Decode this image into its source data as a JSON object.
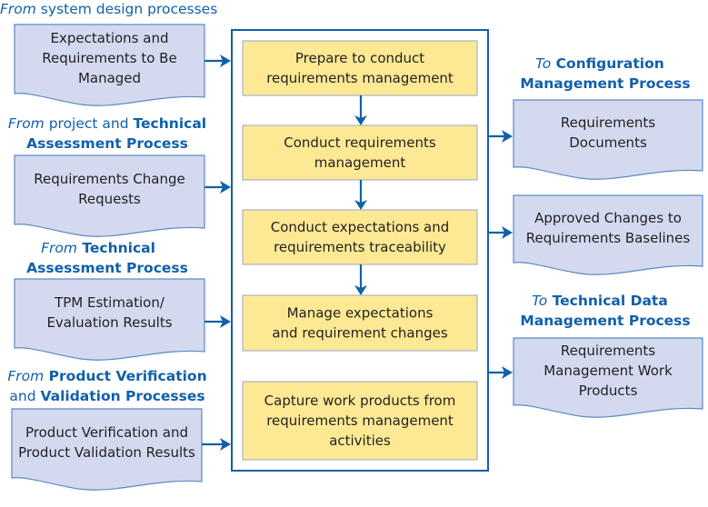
{
  "colors": {
    "accent": "#1060aa",
    "document_fill": "#d3d9ef",
    "step_fill": "#fde994"
  },
  "inputs": [
    {
      "source": [
        [
          "From",
          "italic"
        ],
        [
          " system design processes",
          "normal"
        ]
      ],
      "source2": [],
      "doc": [
        "Expectations and",
        "Requirements to Be",
        "Managed"
      ]
    },
    {
      "source": [
        [
          "From",
          "italic"
        ],
        [
          " project and ",
          "normal"
        ],
        [
          "Technical",
          "bold"
        ]
      ],
      "source2": [
        [
          "Assessment Process",
          "bold"
        ]
      ],
      "doc": [
        "Requirements Change",
        "Requests"
      ]
    },
    {
      "source": [
        [
          "From",
          "italic"
        ],
        [
          " Technical",
          "bold"
        ]
      ],
      "source2": [
        [
          "Assessment Process",
          "bold"
        ]
      ],
      "doc": [
        "TPM Estimation/",
        "Evaluation Results"
      ]
    },
    {
      "source": [
        [
          "From",
          "italic"
        ],
        [
          " Product Verification",
          "bold"
        ]
      ],
      "source2": [
        [
          "and ",
          "normal"
        ],
        [
          "Validation Processes",
          "bold"
        ]
      ],
      "doc": [
        "Product Verification and",
        "Product Validation Results"
      ]
    }
  ],
  "steps": [
    [
      "Prepare to conduct",
      "requirements management"
    ],
    [
      "Conduct requirements",
      "management"
    ],
    [
      "Conduct expectations and",
      "requirements traceability"
    ],
    [
      "Manage expectations",
      "and requirement changes"
    ],
    [
      "Capture work products from",
      "requirements management",
      "activities"
    ]
  ],
  "outputs": [
    {
      "dest": [
        [
          "To",
          "italic"
        ],
        [
          " Configuration",
          "bold"
        ]
      ],
      "dest2": [
        [
          "Management  Process",
          "bold"
        ]
      ],
      "doc": [
        "Requirements",
        "Documents"
      ]
    },
    {
      "dest": [],
      "dest2": [],
      "doc": [
        "Approved Changes to",
        "Requirements Baselines"
      ]
    },
    {
      "dest": [
        [
          "To",
          "italic"
        ],
        [
          " Technical Data",
          "bold"
        ]
      ],
      "dest2": [
        [
          "Management Process",
          "bold"
        ]
      ],
      "doc": [
        "Requirements",
        "Management Work",
        "Products"
      ]
    }
  ]
}
